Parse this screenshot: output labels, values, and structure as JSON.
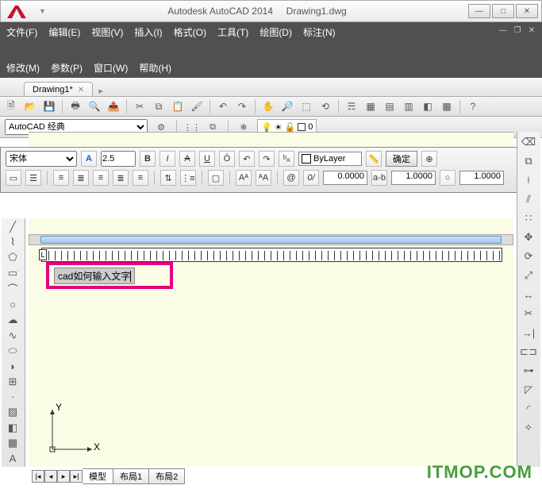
{
  "title": {
    "app": "Autodesk AutoCAD 2014",
    "doc": "Drawing1.dwg"
  },
  "menus": {
    "row1": [
      "文件(F)",
      "编辑(E)",
      "视图(V)",
      "插入(I)",
      "格式(O)",
      "工具(T)",
      "绘图(D)",
      "标注(N)"
    ],
    "row2": [
      "修改(M)",
      "参数(P)",
      "窗口(W)",
      "帮助(H)"
    ]
  },
  "doctab": {
    "label": "Drawing1*"
  },
  "workspace": {
    "selected": "AutoCAD 经典"
  },
  "layer": {
    "current": "0"
  },
  "mtext": {
    "font": "宋体",
    "height": "2.5",
    "colorLabel": "ByLayer",
    "ok": "确定",
    "ratio": "0.0000",
    "tracking1": "1.0000",
    "tracking2": "1.0000"
  },
  "textinput": "cad如何输入文字",
  "ucs": {
    "x": "X",
    "y": "Y"
  },
  "layouts": {
    "model": "模型",
    "l1": "布局1",
    "l2": "布局2"
  },
  "watermark": "ITMOP.COM"
}
